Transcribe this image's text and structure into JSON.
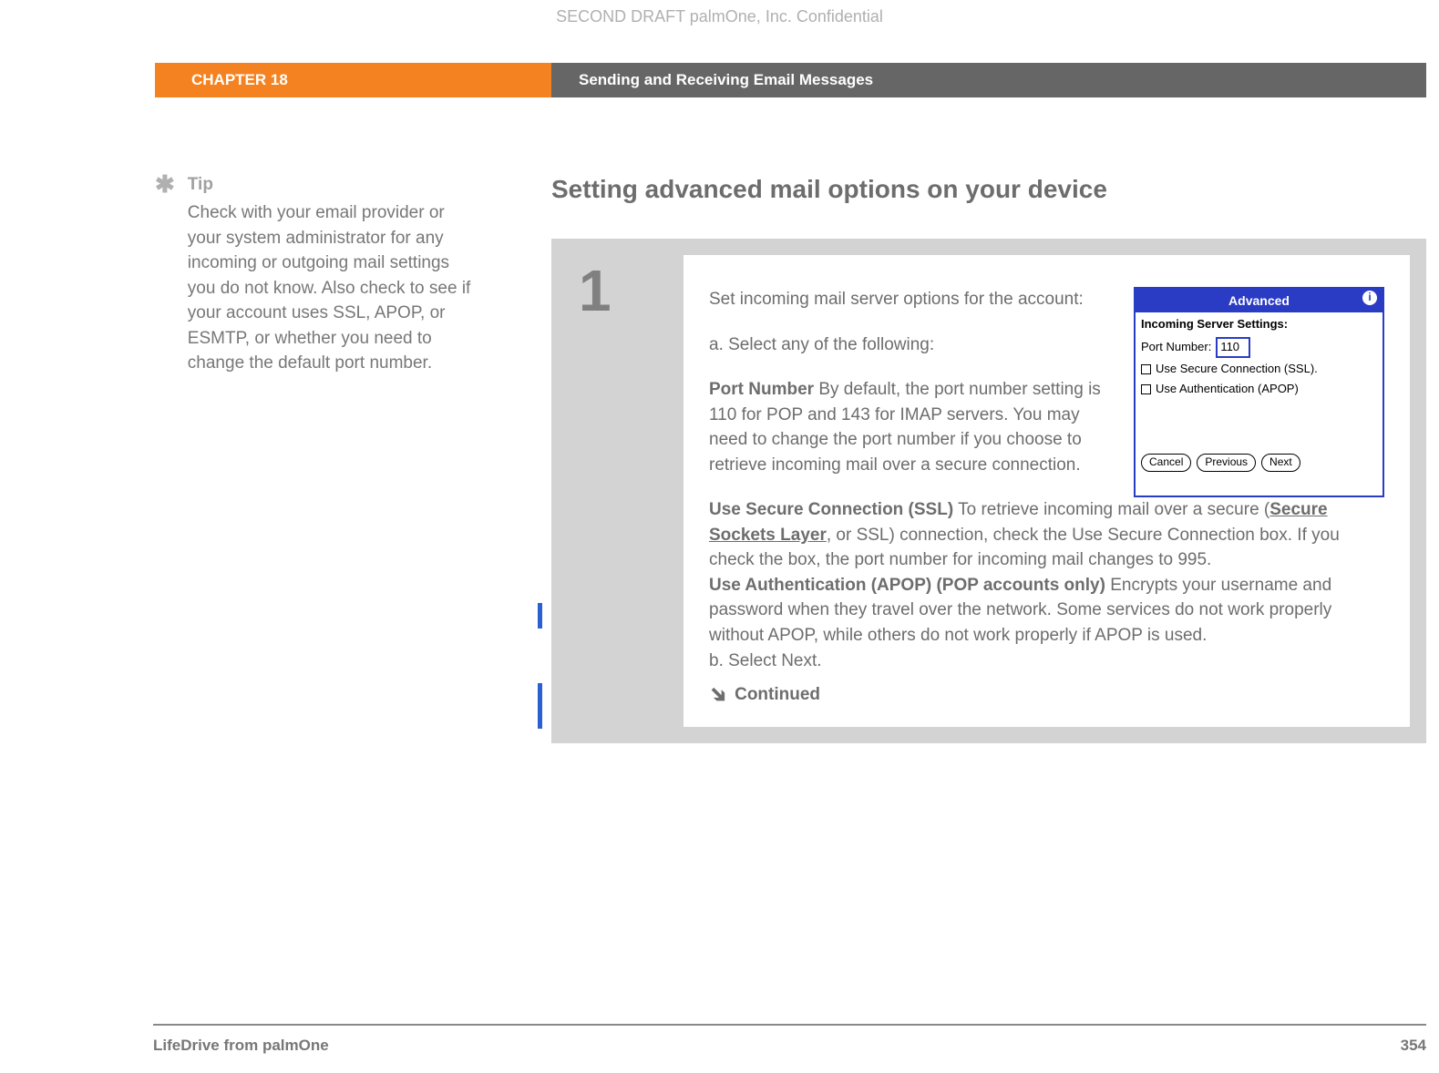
{
  "header": {
    "confidential": "SECOND DRAFT palmOne, Inc.  Confidential",
    "chapter": "CHAPTER 18",
    "title": "Sending and Receiving Email Messages"
  },
  "sidebar": {
    "tip_label": "Tip",
    "tip_text": "Check with your email provider or your system administrator for any incoming or outgoing mail settings you do not know. Also check to see if your account uses SSL, APOP, or ESMTP, or whether you need to change the default port number."
  },
  "main": {
    "section_title": "Setting advanced mail options on your device",
    "step_number": "1",
    "intro": "Set incoming mail server options for the account:",
    "sub_a": "a.  Select any of the following:",
    "port_term": "Port Number",
    "port_desc": "   By default, the port number setting is 110 for POP and 143 for IMAP servers. You may need to change the port number if you choose to retrieve incoming mail over a secure connection.",
    "ssl_term": "Use Secure Connection (SSL)",
    "ssl_pre": "   To retrieve incoming mail over a secure (",
    "ssl_link": "Secure Sockets Layer",
    "ssl_post": ", or SSL) connection, check the Use Secure Connection box. If you check the box, the port number for incoming mail changes to 995.",
    "apop_term": "Use Authentication (APOP) (POP accounts only)",
    "apop_desc": "   Encrypts your username and password when they travel over the network. Some services do not work properly without APOP, while others do not work properly if APOP is used.",
    "sub_b": "b.  Select Next.",
    "continued": "Continued"
  },
  "pda": {
    "title": "Advanced",
    "section": "Incoming Server Settings:",
    "port_label": "Port Number:",
    "port_value": "110",
    "ssl_label": "Use Secure Connection (SSL).",
    "apop_label": "Use Authentication (APOP)",
    "btn_cancel": "Cancel",
    "btn_prev": "Previous",
    "btn_next": "Next"
  },
  "footer": {
    "product": "LifeDrive from palmOne",
    "page": "354"
  }
}
